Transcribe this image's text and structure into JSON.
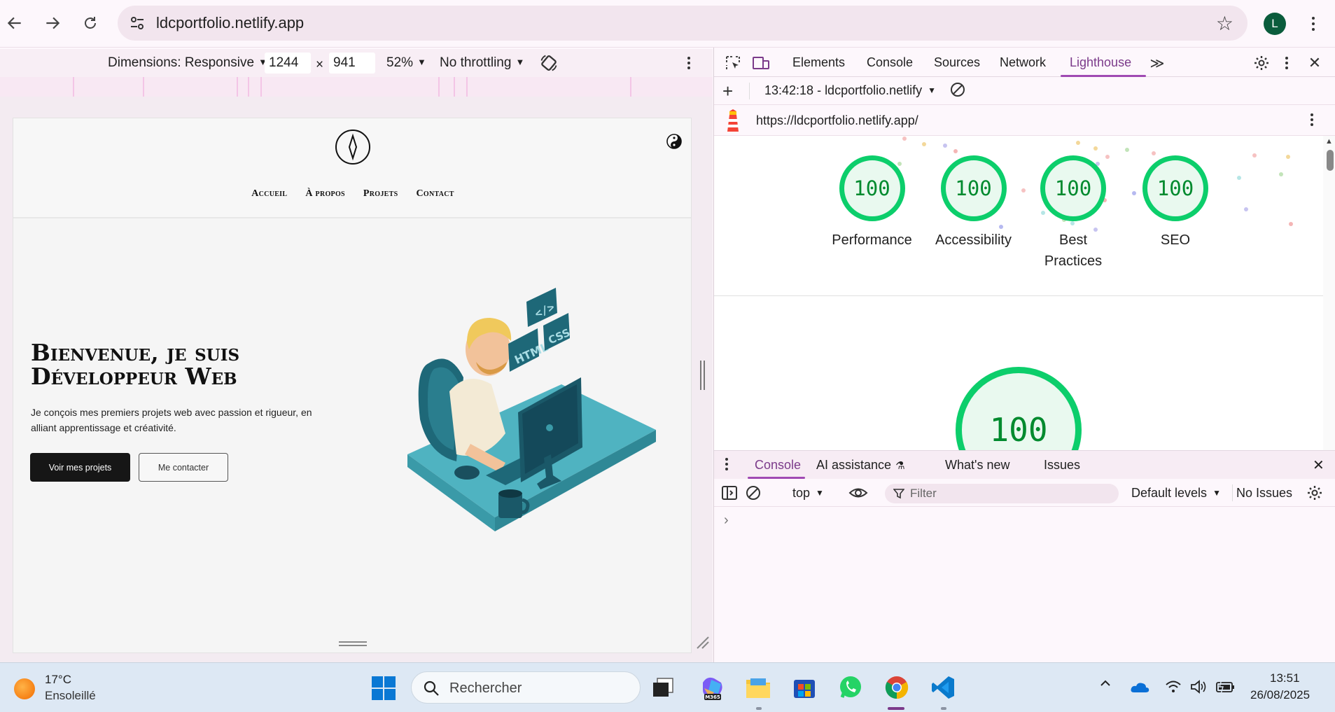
{
  "browser": {
    "url": "ldcportfolio.netlify.app",
    "profile_initial": "L"
  },
  "device_toolbar": {
    "dimensions_label": "Dimensions: Responsive",
    "width": "1244",
    "times": "×",
    "height": "941",
    "zoom": "52%",
    "throttling": "No throttling"
  },
  "site": {
    "nav": [
      "Accueil",
      "À propos",
      "Projets",
      "Contact"
    ],
    "hero_title_line1": "Bienvenue, je suis",
    "hero_title_line2": "Développeur Web",
    "hero_text": "Je conçois mes premiers projets web avec passion et rigueur, en alliant apprentissage et créativité.",
    "btn_primary": "Voir mes projets",
    "btn_secondary": "Me contacter",
    "illustration_tags": [
      "</>",
      "HTML",
      "CSS"
    ]
  },
  "devtools": {
    "tabs": [
      "Elements",
      "Console",
      "Sources",
      "Network",
      "Lighthouse"
    ],
    "active_tab": "Lighthouse",
    "report_selector": "13:42:18 - ldcportfolio.netlify",
    "report_url": "https://ldcportfolio.netlify.app/",
    "scores": [
      {
        "label": "Performance",
        "value": "100"
      },
      {
        "label": "Accessibility",
        "value": "100"
      },
      {
        "label": "Best Practices",
        "value": "100"
      },
      {
        "label": "SEO",
        "value": "100"
      }
    ],
    "big_score": "100",
    "score_color": "#0cce6b"
  },
  "drawer": {
    "tabs": [
      "Console",
      "AI assistance",
      "What's new",
      "Issues"
    ],
    "active_tab": "Console",
    "context": "top",
    "filter_placeholder": "Filter",
    "levels": "Default levels",
    "issues": "No Issues",
    "prompt": "›"
  },
  "taskbar": {
    "temperature": "17°C",
    "weather": "Ensoleillé",
    "search_placeholder": "Rechercher",
    "time": "13:51",
    "date": "26/08/2025"
  }
}
